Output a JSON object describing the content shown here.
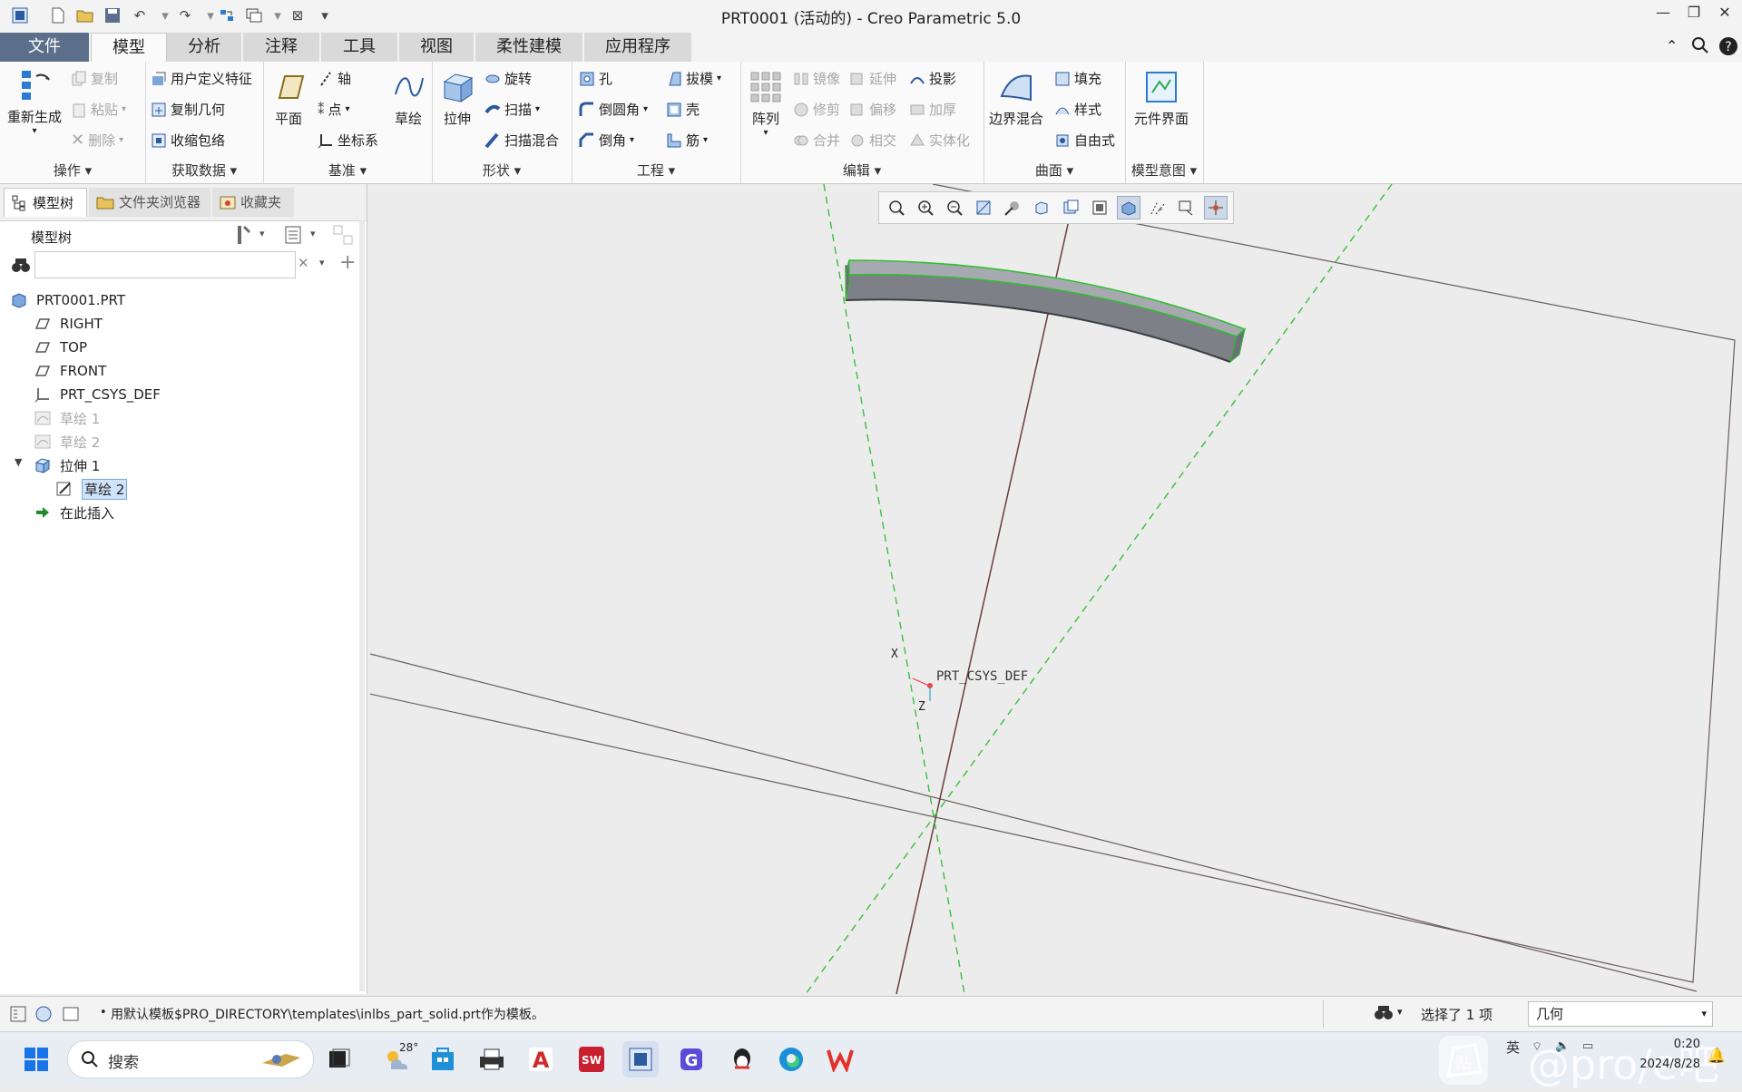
{
  "window": {
    "title": "PRT0001 (活动的) - Creo Parametric 5.0"
  },
  "tabs": [
    {
      "label": "文件"
    },
    {
      "label": "模型"
    },
    {
      "label": "分析"
    },
    {
      "label": "注释"
    },
    {
      "label": "工具"
    },
    {
      "label": "视图"
    },
    {
      "label": "柔性建模"
    },
    {
      "label": "应用程序"
    }
  ],
  "ribbon": {
    "operations": {
      "label": "操作",
      "regenerate": "重新生成",
      "copy": "复制",
      "paste": "粘贴",
      "delete": "删除"
    },
    "get_data": {
      "label": "获取数据",
      "udf": "用户定义特征",
      "copy_geom": "复制几何",
      "shrinkwrap": "收缩包络"
    },
    "datum": {
      "label": "基准",
      "plane": "平面",
      "axis": "轴",
      "point": "点",
      "csys": "坐标系",
      "sketch": "草绘"
    },
    "shapes": {
      "label": "形状",
      "extrude": "拉伸",
      "revolve": "旋转",
      "sweep": "扫描",
      "swept_blend": "扫描混合"
    },
    "engineering": {
      "label": "工程",
      "hole": "孔",
      "round": "倒圆角",
      "chamfer": "倒角",
      "draft": "拔模",
      "shell": "壳",
      "rib": "筋"
    },
    "editing": {
      "label": "编辑",
      "pattern": "阵列",
      "mirror": "镜像",
      "extend": "延伸",
      "project": "投影",
      "trim": "修剪",
      "offset": "偏移",
      "thicken": "加厚",
      "merge": "合并",
      "intersect": "相交",
      "solidify": "实体化"
    },
    "surfaces": {
      "label": "曲面",
      "boundary_blend": "边界混合",
      "fill": "填充",
      "style": "样式",
      "freestyle": "自由式"
    },
    "model_intent": {
      "label": "模型意图",
      "component_interface": "元件界面"
    }
  },
  "left_panel": {
    "tabs": [
      {
        "label": "模型树"
      },
      {
        "label": "文件夹浏览器"
      },
      {
        "label": "收藏夹"
      }
    ],
    "header": "模型树",
    "search": {
      "value": "",
      "placeholder": ""
    },
    "tree": [
      {
        "label": "PRT0001.PRT",
        "icon": "part-icon",
        "state": "normal"
      },
      {
        "label": "RIGHT",
        "icon": "datum-plane-icon",
        "state": "normal"
      },
      {
        "label": "TOP",
        "icon": "datum-plane-icon",
        "state": "normal"
      },
      {
        "label": "FRONT",
        "icon": "datum-plane-icon",
        "state": "normal"
      },
      {
        "label": "PRT_CSYS_DEF",
        "icon": "csys-icon",
        "state": "normal"
      },
      {
        "label": "草绘 1",
        "icon": "sketch-icon",
        "state": "hidden"
      },
      {
        "label": "草绘 2",
        "icon": "sketch-icon",
        "state": "hidden"
      },
      {
        "label": "拉伸 1",
        "icon": "extrude-icon",
        "state": "expanded"
      },
      {
        "label": "草绘 2",
        "icon": "sketch-icon",
        "state": "selected"
      },
      {
        "label": "在此插入",
        "icon": "insert-arrow-icon",
        "state": "insert"
      }
    ]
  },
  "viewport": {
    "csys_label": "PRT_CSYS_DEF",
    "axis_x": "X",
    "axis_z": "Z"
  },
  "status": {
    "message": "用默认模板$PRO_DIRECTORY\\templates\\inlbs_part_solid.prt作为模板。",
    "selection": "选择了 1 项",
    "filter": "几何"
  },
  "taskbar": {
    "search_placeholder": "搜索",
    "weather": "28°",
    "lang": "英",
    "time": "0:20",
    "date": "2024/8/28",
    "watermark": "@pro/e吧"
  },
  "colors": {
    "accent": "#5b6e8a",
    "datum_green": "#2fbf2f",
    "model_gray": "#8e9296",
    "selection_blue": "#cfe3fb"
  }
}
